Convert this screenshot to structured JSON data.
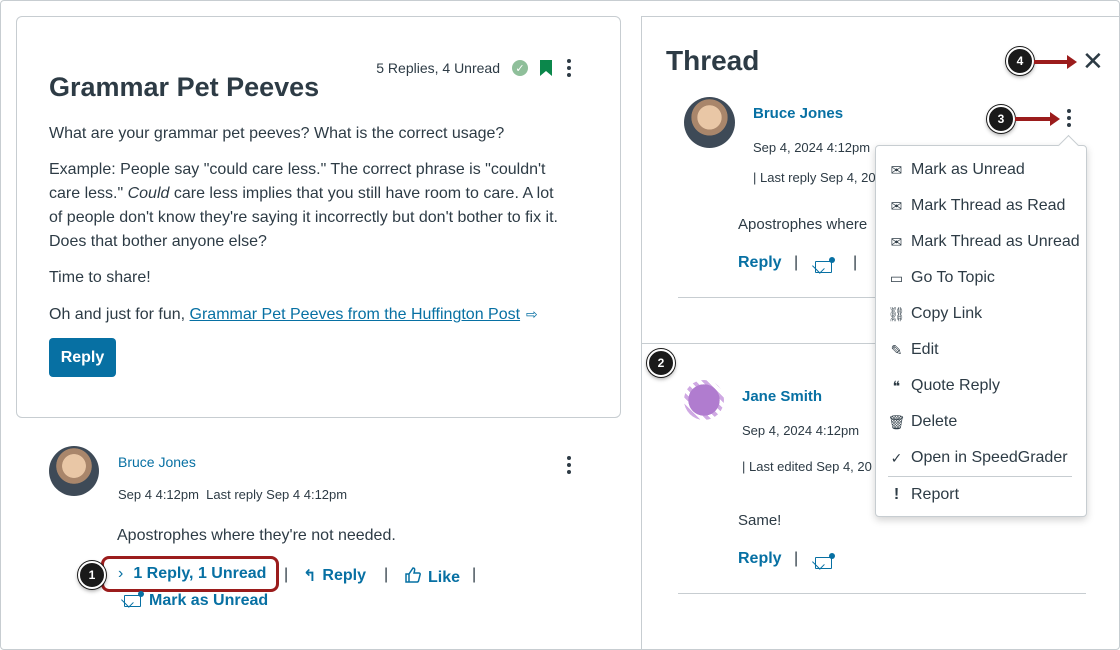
{
  "post": {
    "meta": "5 Replies, 4 Unread",
    "title": "Grammar Pet Peeves",
    "paragraph1": "What are your grammar pet peeves? What is the correct usage?",
    "paragraph2_a": "Example: People say \"could care less.\" The correct phrase is \"couldn't care less.\" ",
    "paragraph2_em": "Could",
    "paragraph2_b": " care less implies that you still have room to care. A lot of people don't know they're saying it incorrectly but don't bother to fix it. Does that bother anyone else?",
    "paragraph3": "Time to share!",
    "paragraph4_prefix": "Oh and just for fun, ",
    "paragraph4_link": "Grammar Pet Peeves from the Huffington Post",
    "reply_button": "Reply"
  },
  "entry": {
    "author": "Bruce Jones",
    "meta": "Sep 4 4:12pm  Last reply Sep 4 4:12pm",
    "text": "Apostrophes where they're not needed.",
    "replies_toggle": "1 Reply, 1 Unread",
    "reply": "Reply",
    "like": "Like",
    "mark_unread": "Mark as Unread",
    "separator": "|"
  },
  "thread": {
    "title": "Thread",
    "first": {
      "author": "Bruce Jones",
      "date": "Sep 4, 2024 4:12pm",
      "last_reply": "| Last reply Sep 4, 20",
      "text": "Apostrophes where",
      "reply": "Reply",
      "separator": "|"
    },
    "second": {
      "author": "Jane Smith",
      "date": "Sep 4, 2024 4:12pm",
      "last_edited": "| Last edited Sep 4, 20",
      "text": "Same!",
      "reply": "Reply",
      "separator": "|"
    }
  },
  "menu": {
    "items": [
      {
        "label": "Mark as Unread",
        "icon": "mail-unread-icon"
      },
      {
        "label": "Mark Thread as Read",
        "icon": "mail-open-icon"
      },
      {
        "label": "Mark Thread as Unread",
        "icon": "mail-unread-icon"
      },
      {
        "label": "Go To Topic",
        "icon": "discussion-icon"
      },
      {
        "label": "Copy Link",
        "icon": "link-icon"
      },
      {
        "label": "Edit",
        "icon": "edit-icon"
      },
      {
        "label": "Quote Reply",
        "icon": "quote-icon"
      },
      {
        "label": "Delete",
        "icon": "trash-icon"
      },
      {
        "label": "Open in SpeedGrader",
        "icon": "speedgrader-icon"
      },
      {
        "label": "Report",
        "icon": "warning-icon"
      }
    ]
  },
  "callouts": {
    "one": "1",
    "two": "2",
    "three": "3",
    "four": "4"
  },
  "colors": {
    "link": "#0770a3",
    "callout_arrow": "#9b1c1c",
    "bookmark": "#0b874b",
    "check": "#8fbf9a"
  }
}
